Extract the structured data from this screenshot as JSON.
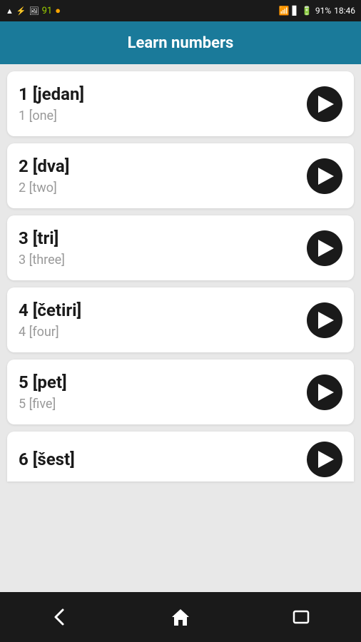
{
  "statusBar": {
    "time": "18:46",
    "battery": "91%"
  },
  "header": {
    "title": "Learn numbers"
  },
  "items": [
    {
      "id": 1,
      "primary": "1 [jedan]",
      "secondary": "1 [one]"
    },
    {
      "id": 2,
      "primary": "2 [dva]",
      "secondary": "2 [two]"
    },
    {
      "id": 3,
      "primary": "3 [tri]",
      "secondary": "3 [three]"
    },
    {
      "id": 4,
      "primary": "4 [četiri]",
      "secondary": "4 [four]"
    },
    {
      "id": 5,
      "primary": "5 [pet]",
      "secondary": "5 [five]"
    }
  ],
  "partialItem": {
    "primary": "6 [šest]"
  }
}
